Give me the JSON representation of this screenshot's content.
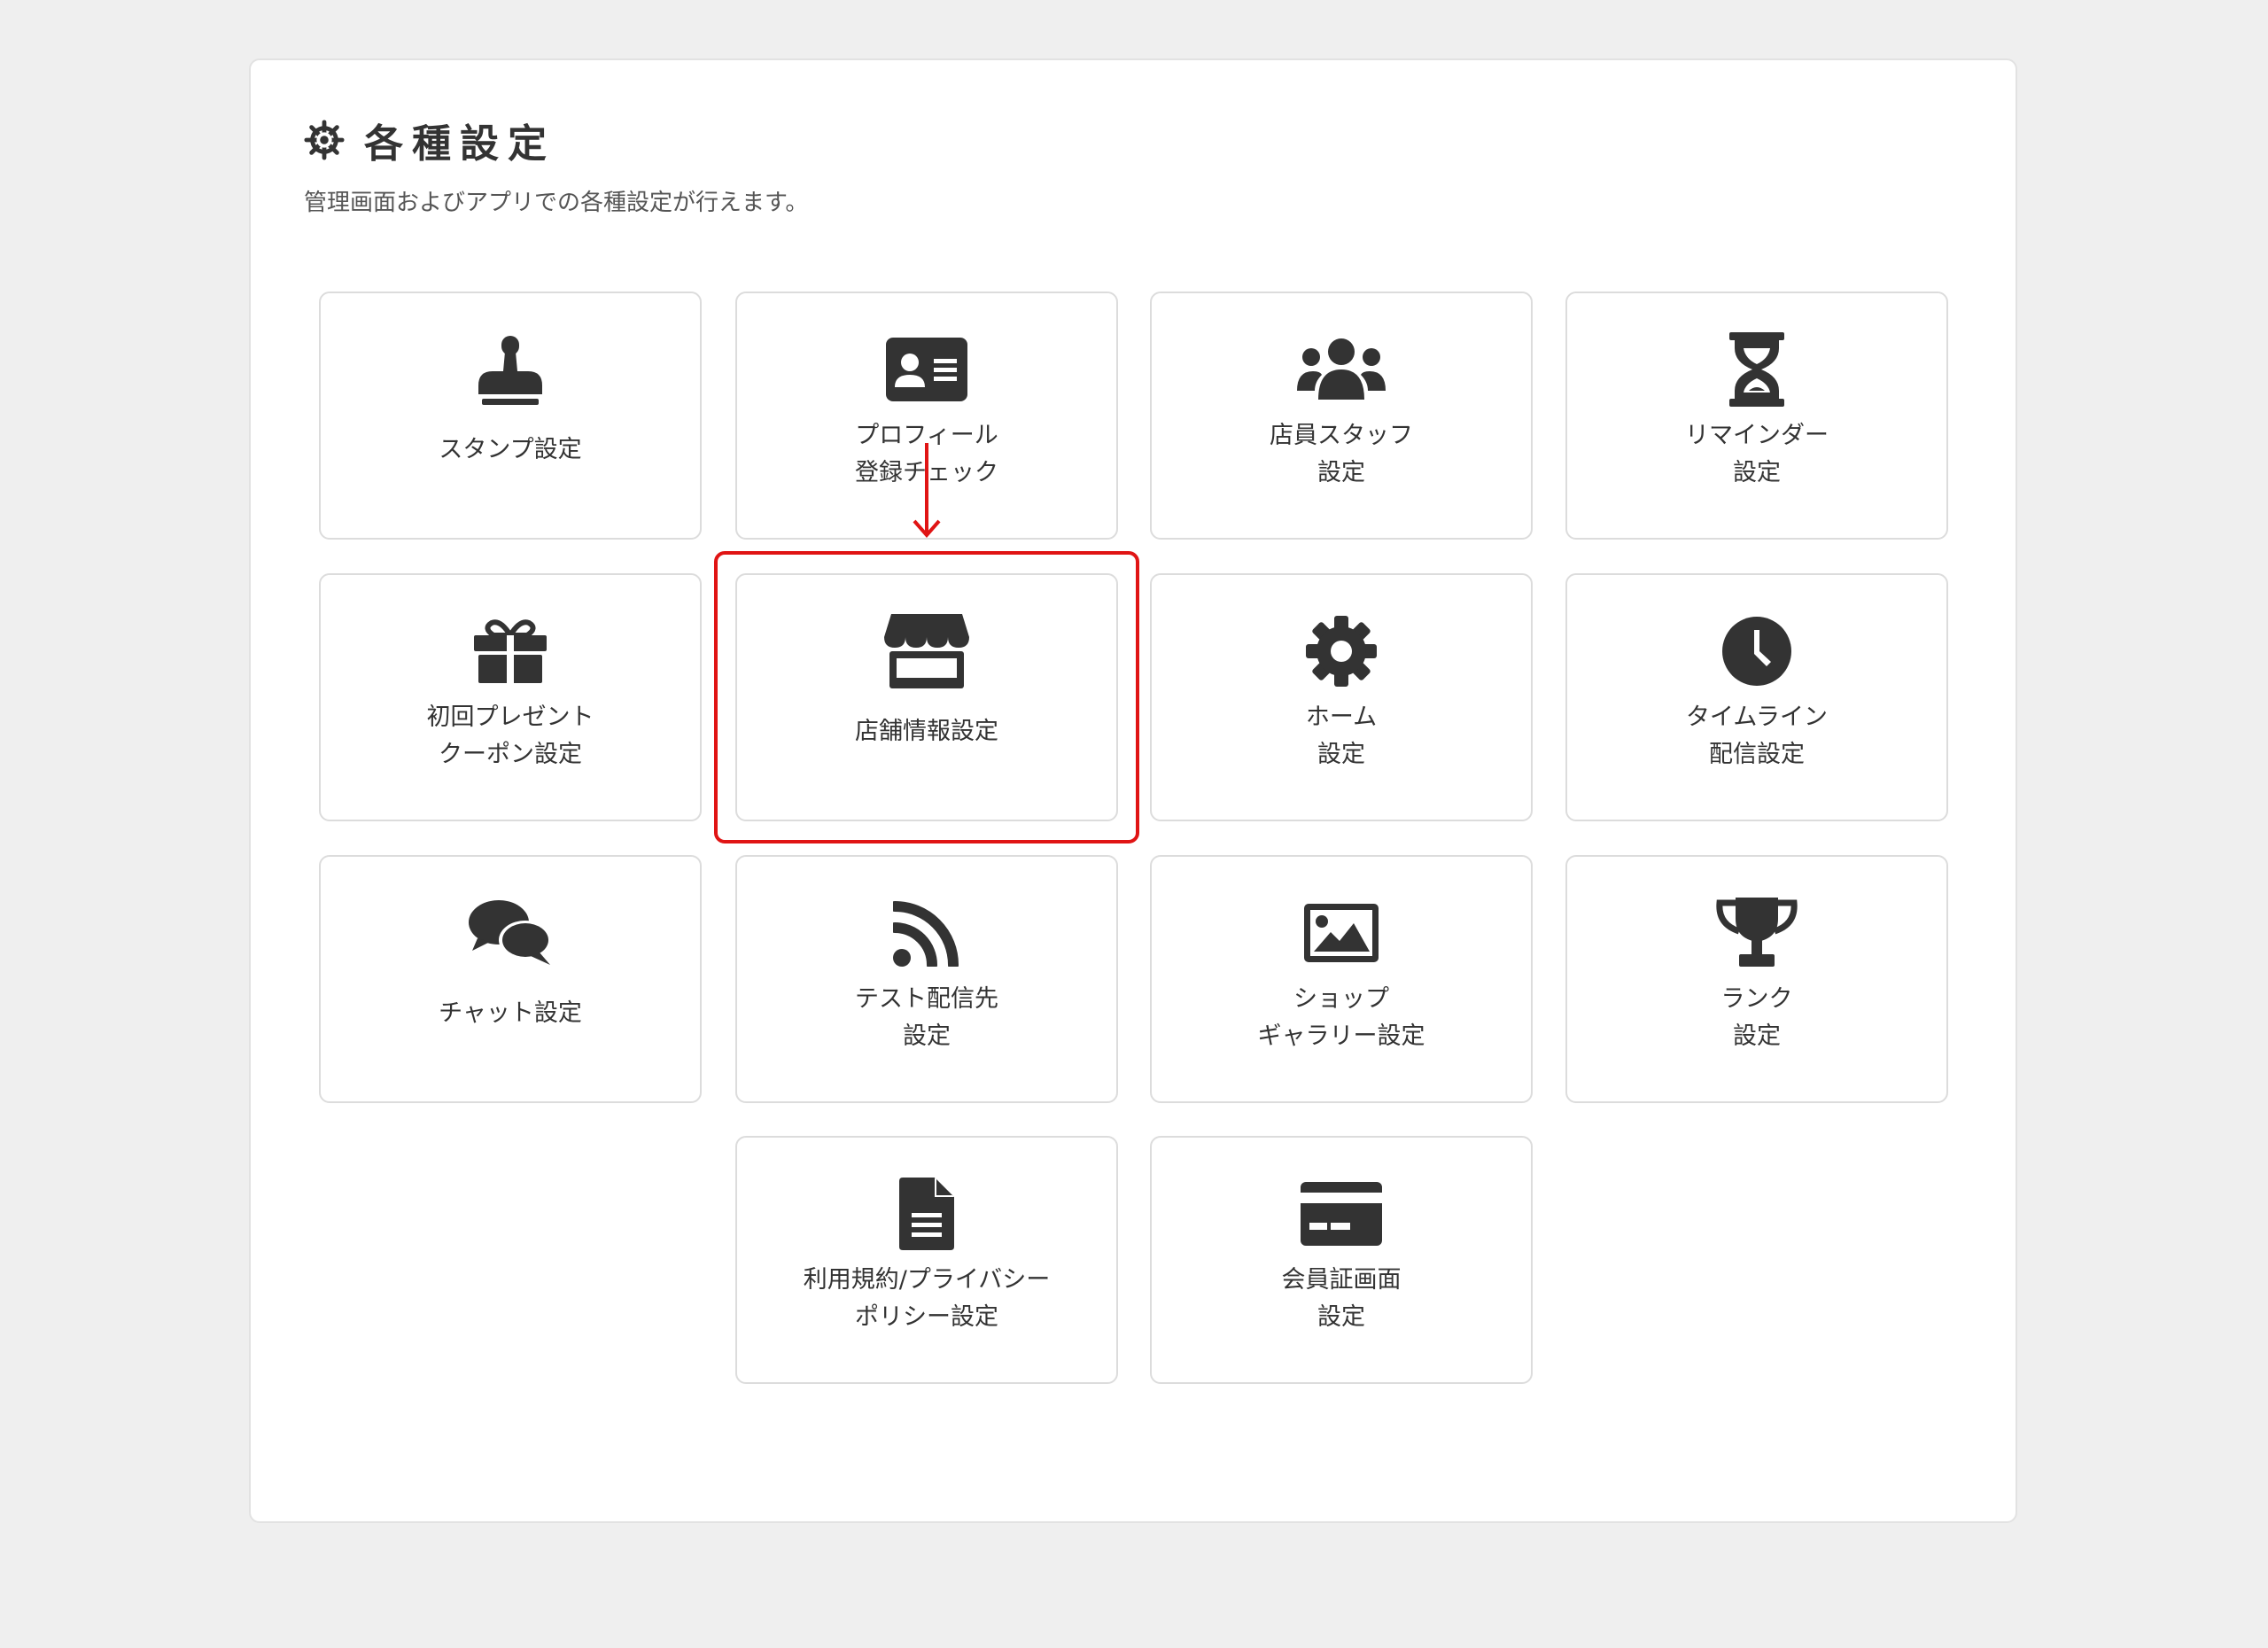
{
  "header": {
    "title": "各種設定",
    "subtitle": "管理画面およびアプリでの各種設定が行えます。"
  },
  "cards": [
    {
      "icon": "stamp-icon",
      "lines": [
        "スタンプ設定"
      ]
    },
    {
      "icon": "id-card-icon",
      "lines": [
        "プロフィール",
        "登録チェック"
      ]
    },
    {
      "icon": "users-icon",
      "lines": [
        "店員スタッフ",
        "設定"
      ]
    },
    {
      "icon": "hourglass-icon",
      "lines": [
        "リマインダー",
        "設定"
      ]
    },
    {
      "icon": "gift-icon",
      "lines": [
        "初回プレゼント",
        "クーポン設定"
      ]
    },
    {
      "icon": "store-icon",
      "lines": [
        "店舗情報設定"
      ]
    },
    {
      "icon": "gear-icon",
      "lines": [
        "ホーム",
        "設定"
      ]
    },
    {
      "icon": "clock-icon",
      "lines": [
        "タイムライン",
        "配信設定"
      ]
    },
    {
      "icon": "chat-bubbles-icon",
      "lines": [
        "チャット設定"
      ]
    },
    {
      "icon": "rss-icon",
      "lines": [
        "テスト配信先",
        "設定"
      ]
    },
    {
      "icon": "image-icon",
      "lines": [
        "ショップ",
        "ギャラリー設定"
      ]
    },
    {
      "icon": "trophy-icon",
      "lines": [
        "ランク",
        "設定"
      ]
    },
    {
      "icon": "document-icon",
      "lines": [
        "利用規約/プライバシー",
        "ポリシー設定"
      ]
    },
    {
      "icon": "credit-card-icon",
      "lines": [
        "会員証画面",
        "設定"
      ]
    }
  ],
  "colors": {
    "background": "#efefef",
    "panel": "#ffffff",
    "icon": "#333333",
    "highlight": "#e01414"
  }
}
